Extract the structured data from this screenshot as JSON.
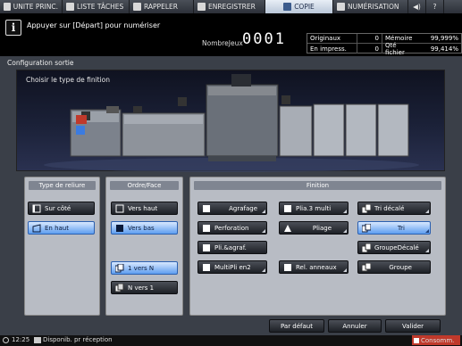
{
  "tabs": [
    {
      "label": "UNITE PRINC.",
      "icon": "home-icon"
    },
    {
      "label": "LISTE TÂCHES",
      "icon": "list-icon"
    },
    {
      "label": "RAPPELER",
      "icon": "recall-icon"
    },
    {
      "label": "ENREGISTRER",
      "icon": "save-icon"
    },
    {
      "label": "COPIE",
      "icon": "copy-icon"
    },
    {
      "label": "NUMÉRISATION",
      "icon": "scan-icon"
    }
  ],
  "tab_icons": {
    "volume": "◀)",
    "help": "?"
  },
  "message": {
    "text": "Appuyer sur [Départ] pour numériser",
    "icon": "i"
  },
  "counter": {
    "label": "NombreJeux",
    "value": "0001"
  },
  "status": {
    "originals_label": "Originaux",
    "originals_value": "0",
    "memory_label": "Mémoire",
    "memory_value": "99,999%",
    "printing_label": "En impress.",
    "printing_value": "0",
    "file_label": "Qté fichier",
    "file_value": "99,414%"
  },
  "panel": {
    "title": "Configuration sortie",
    "preview_title": "Choisir le type de finition"
  },
  "binding": {
    "title": "Type de reliure",
    "buttons": [
      {
        "label": "Sur côté",
        "selected": false
      },
      {
        "label": "En haut",
        "selected": true
      }
    ]
  },
  "order": {
    "title": "Ordre/Face",
    "buttons": [
      {
        "label": "Vers haut",
        "selected": false
      },
      {
        "label": "Vers bas",
        "selected": true
      },
      {
        "label": "1 vers N",
        "selected": true
      },
      {
        "label": "N vers 1",
        "selected": false
      }
    ]
  },
  "finish": {
    "title": "Finition",
    "buttons": [
      {
        "label": "Agrafage",
        "selected": false
      },
      {
        "label": "Plia.3 multi",
        "selected": false
      },
      {
        "label": "Tri décalé",
        "selected": false
      },
      {
        "label": "Perforation",
        "selected": false
      },
      {
        "label": "Pliage",
        "selected": false
      },
      {
        "label": "Tri",
        "selected": true
      },
      {
        "label": "Pli.&agraf.",
        "selected": false
      },
      {
        "label": "GroupeDécalé",
        "selected": false
      },
      {
        "label": "MultiPli en2",
        "selected": false
      },
      {
        "label": "Rel. anneaux",
        "selected": false
      },
      {
        "label": "Groupe",
        "selected": false
      }
    ]
  },
  "actions": {
    "default_label": "Par défaut",
    "cancel_label": "Annuler",
    "ok_label": "Valider"
  },
  "footer": {
    "time": "12:25",
    "status": "Disponib. pr réception",
    "consumables": "Consomm."
  },
  "colors": {
    "selected": "#5e9ef0",
    "active_tab": "#e8eef6",
    "consumables": "#c0392b"
  }
}
